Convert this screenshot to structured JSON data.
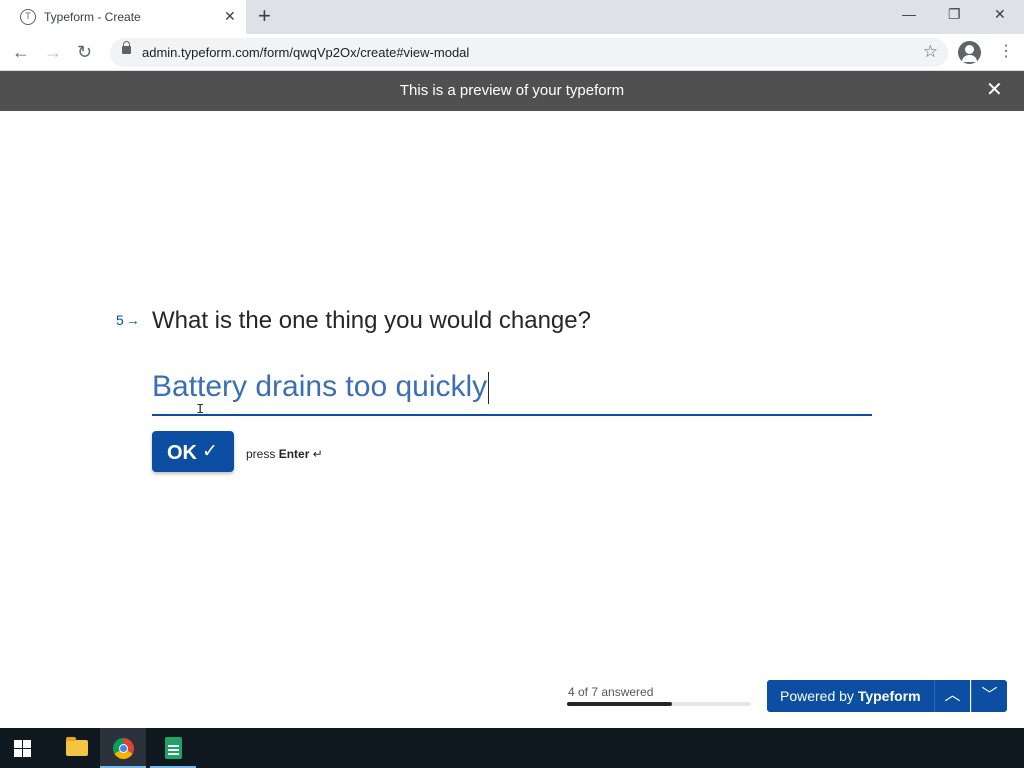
{
  "browser": {
    "tab_title": "Typeform - Create",
    "tab_favicon_letter": "T",
    "url": "admin.typeform.com/form/qwqVp2Ox/create#view-modal"
  },
  "preview_bar": {
    "text": "This is a preview of your typeform"
  },
  "question": {
    "number": "5",
    "arrow": "→",
    "text": "What is the one thing you would change?",
    "answer_value": "Battery drains too quickly"
  },
  "ok_button": {
    "label": "OK",
    "check": "✓"
  },
  "hint": {
    "prefix": "press",
    "key": "Enter",
    "symbol": "↵"
  },
  "progress": {
    "label": "4 of 7 answered",
    "answered": 4,
    "total": 7
  },
  "branding": {
    "powered_by": "Powered by",
    "brand": "Typeform"
  },
  "colors": {
    "accent": "#0b4ea2",
    "answer_text": "#3a6fb5",
    "preview_bar": "#505050"
  }
}
